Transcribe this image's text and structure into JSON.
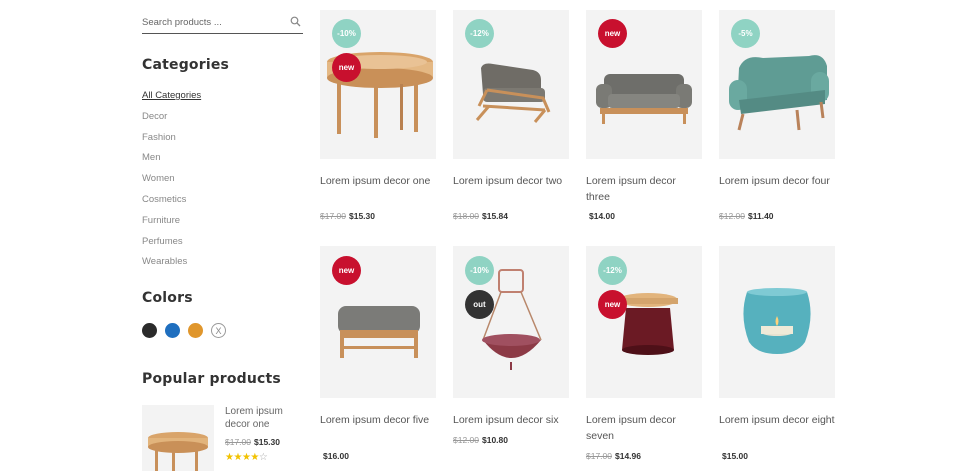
{
  "search": {
    "placeholder": "Search products ..."
  },
  "sidebar": {
    "categories_title": "Categories",
    "categories": [
      {
        "label": "All Categories"
      },
      {
        "label": "Decor"
      },
      {
        "label": "Fashion"
      },
      {
        "label": "Men"
      },
      {
        "label": "Women"
      },
      {
        "label": "Cosmetics"
      },
      {
        "label": "Furniture"
      },
      {
        "label": "Perfumes"
      },
      {
        "label": "Wearables"
      }
    ],
    "colors_title": "Colors",
    "colors": [
      {
        "name": "black",
        "hex": "#2b2b2b"
      },
      {
        "name": "blue",
        "hex": "#1f6fbf"
      },
      {
        "name": "orange",
        "hex": "#e0962c"
      }
    ],
    "clear_color_icon": "X",
    "popular_title": "Popular products",
    "popular": [
      {
        "name": "Lorem ipsum decor one",
        "old_price": "$17.00",
        "price": "$15.30",
        "rating": 4,
        "rating_max": 5
      }
    ]
  },
  "products": [
    {
      "name": "Lorem ipsum decor one",
      "old_price": "$17.00",
      "price": "$15.30",
      "badges": [
        "-10%",
        "new"
      ]
    },
    {
      "name": "Lorem ipsum decor two",
      "old_price": "$18.00",
      "price": "$15.84",
      "badges": [
        "-12%"
      ]
    },
    {
      "name": "Lorem ipsum decor three",
      "old_price": "",
      "price": "$14.00",
      "badges": [
        "new"
      ]
    },
    {
      "name": "Lorem ipsum decor four",
      "old_price": "$12.00",
      "price": "$11.40",
      "badges": [
        "-5%"
      ]
    },
    {
      "name": "Lorem ipsum decor five",
      "old_price": "",
      "price": "$16.00",
      "badges": [
        "new"
      ]
    },
    {
      "name": "Lorem ipsum decor six",
      "old_price": "$12.00",
      "price": "$10.80",
      "badges": [
        "-10%",
        "out"
      ]
    },
    {
      "name": "Lorem ipsum decor seven",
      "old_price": "$17.00",
      "price": "$14.96",
      "badges": [
        "-12%",
        "new"
      ]
    },
    {
      "name": "Lorem ipsum decor eight",
      "old_price": "",
      "price": "$15.00",
      "badges": []
    }
  ],
  "theme": {
    "badge_teal": "#8fd3c3",
    "badge_red": "#c8102e",
    "badge_dark": "#333333",
    "star": "#f2c200"
  }
}
